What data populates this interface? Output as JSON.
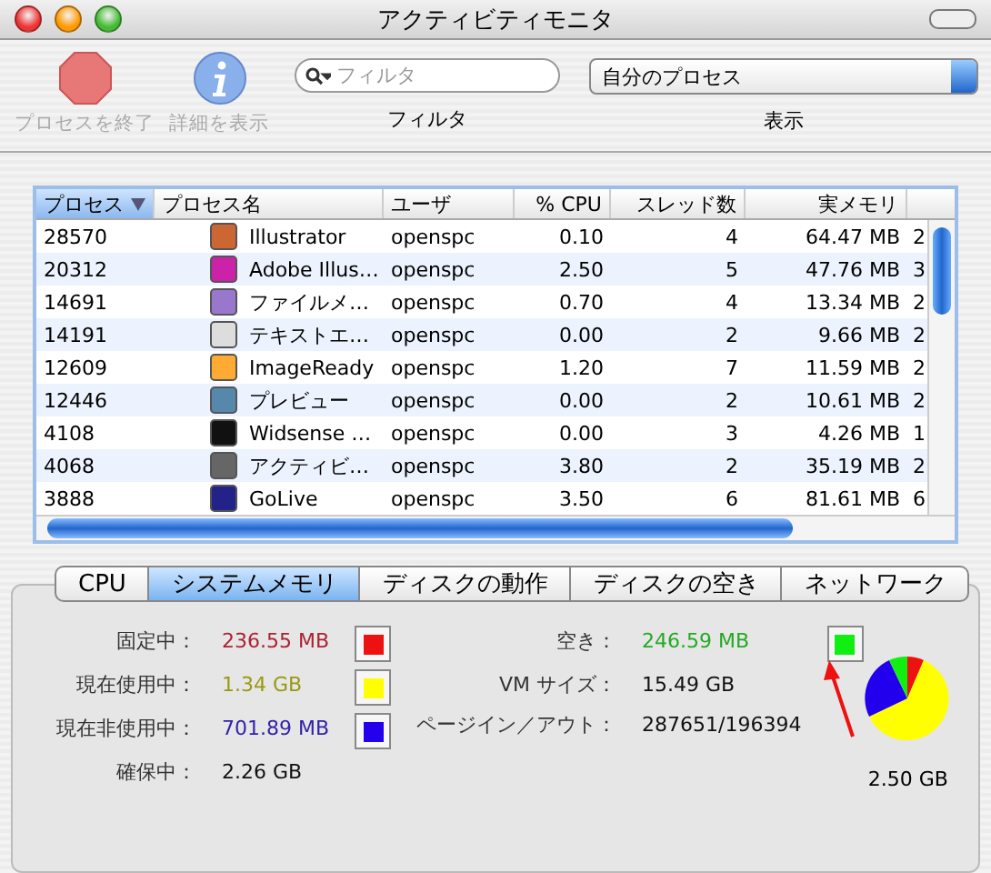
{
  "window": {
    "title": "アクティビティモニタ"
  },
  "toolbar": {
    "buttons": [
      {
        "label": "プロセスを終了",
        "kind": "stop",
        "disabled": true
      },
      {
        "label": "詳細を表示",
        "kind": "info",
        "disabled": true
      }
    ],
    "search": {
      "placeholder": "フィルタ",
      "label": "フィルタ"
    },
    "show": {
      "value": "自分のプロセス",
      "label": "表示"
    }
  },
  "table": {
    "columns": [
      "プロセス",
      "プロセス名",
      "ユーザ",
      "% CPU",
      "スレッド数",
      "実メモリ"
    ],
    "rows": [
      {
        "pid": "28570",
        "name": "Illustrator",
        "user": "openspc",
        "cpu": "0.10",
        "threads": "4",
        "memory": "64.47 MB",
        "column_7": "2"
      },
      {
        "pid": "20312",
        "name": "Adobe Illus…",
        "user": "openspc",
        "cpu": "2.50",
        "threads": "5",
        "memory": "47.76 MB",
        "column_7": "3"
      },
      {
        "pid": "14691",
        "name": "ファイルメ…",
        "user": "openspc",
        "cpu": "0.70",
        "threads": "4",
        "memory": "13.34 MB",
        "column_7": "2"
      },
      {
        "pid": "14191",
        "name": "テキストエ…",
        "user": "openspc",
        "cpu": "0.00",
        "threads": "2",
        "memory": "9.66 MB",
        "column_7": "2"
      },
      {
        "pid": "12609",
        "name": "ImageReady",
        "user": "openspc",
        "cpu": "1.20",
        "threads": "7",
        "memory": "11.59 MB",
        "column_7": "2"
      },
      {
        "pid": "12446",
        "name": "プレビュー",
        "user": "openspc",
        "cpu": "0.00",
        "threads": "2",
        "memory": "10.61 MB",
        "column_7": "2"
      },
      {
        "pid": "4108",
        "name": "Widsense …",
        "user": "openspc",
        "cpu": "0.00",
        "threads": "3",
        "memory": "4.26 MB",
        "column_7": "1"
      },
      {
        "pid": "4068",
        "name": "アクティビ…",
        "user": "openspc",
        "cpu": "3.80",
        "threads": "2",
        "memory": "35.19 MB",
        "column_7": "2"
      },
      {
        "pid": "3888",
        "name": "GoLive",
        "user": "openspc",
        "cpu": "3.50",
        "threads": "6",
        "memory": "81.61 MB",
        "column_7": "6"
      }
    ]
  },
  "tabs": [
    {
      "label": "CPU",
      "selected": false
    },
    {
      "label": "システムメモリ",
      "selected": true
    },
    {
      "label": "ディスクの動作",
      "selected": false
    },
    {
      "label": "ディスクの空き",
      "selected": false
    },
    {
      "label": "ネットワーク",
      "selected": false
    }
  ],
  "memory": {
    "legend": [
      {
        "label": "固定中：",
        "value": "236.55 MB",
        "color": "#ee1111"
      },
      {
        "label": "現在使用中：",
        "value": "1.34 GB",
        "color": "#ffff00"
      },
      {
        "label": "現在非使用中：",
        "value": "701.89 MB",
        "color": "#2200ee"
      }
    ],
    "reserved": {
      "label": "確保中：",
      "value": "2.26 GB"
    },
    "free": {
      "label": "空き：",
      "value": "246.59 MB",
      "color": "#11ee11"
    },
    "stats": [
      {
        "label": "VM サイズ：",
        "value": "15.49 GB"
      },
      {
        "label": "ページイン／アウト：",
        "value": "287651/196394"
      }
    ],
    "total": "2.50 GB"
  }
}
